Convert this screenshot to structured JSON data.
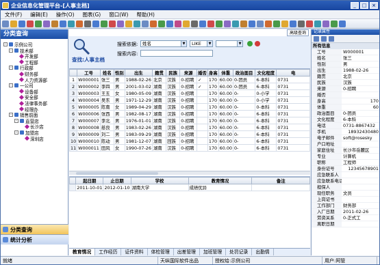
{
  "window": {
    "title": "企业信息化管理平台-[人事主档]"
  },
  "menu": [
    "文件(F)",
    "编辑(E)",
    "操作(O)",
    "图表(G)",
    "窗口(W)",
    "帮助(H)"
  ],
  "left": {
    "title": "分类查询",
    "tree": [
      "示例公司",
      "技术部",
      "开发部",
      "工程部",
      "行政部",
      "财务部",
      "人力资源部",
      "一公司",
      "设备部",
      "安全部",
      "法律事务部",
      "经理办",
      "销售前面",
      "直营店",
      "长沙店",
      "加盟店",
      "深圳店"
    ],
    "buttons": [
      "分类查询",
      "统计分析"
    ]
  },
  "search": {
    "tab": "高级查询",
    "label": "查找:人事主档",
    "by_label": "搜索依据:",
    "by_value": "姓名",
    "op_value": "LIKE",
    "content_label": "搜索内容:",
    "content_value": ""
  },
  "grid": {
    "columns": [
      "工号",
      "姓名",
      "性别",
      "出生",
      "籍贯",
      "民族",
      "来源",
      "婚否",
      "身高",
      "体重",
      "政治面目",
      "文化程度",
      "电"
    ],
    "rows": [
      [
        "1",
        "W000001",
        "张三",
        "男",
        "1988-02-26",
        "北京",
        "汉族",
        "0-招聘",
        "✓",
        "170",
        "60.00",
        "0-团员",
        "6-本科",
        "0731"
      ],
      [
        "2",
        "W000002",
        "李四",
        "男",
        "2001-03-02",
        "湖南",
        "汉族",
        "0-招聘",
        "✓",
        "170",
        "60.00",
        "0-团员",
        "6-本科",
        "0731"
      ],
      [
        "3",
        "W000003",
        "王五",
        "女",
        "1980-05-09",
        "湖南",
        "汉族",
        "0-招聘",
        "",
        "170",
        "60.00",
        "0-",
        "0-小学",
        "0731"
      ],
      [
        "4",
        "W000004",
        "吴东",
        "男",
        "1971-12-29",
        "湖南",
        "汉族",
        "0-招聘",
        "",
        "170",
        "60.00",
        "0-",
        "0-小学",
        "0731"
      ],
      [
        "5",
        "W000005",
        "陈南",
        "女",
        "1989-04-29",
        "湖南",
        "汉族",
        "0-招聘",
        "",
        "170",
        "60.00",
        "0-",
        "0-本科",
        "0731"
      ],
      [
        "6",
        "W000006",
        "张西",
        "男",
        "1982-08-17",
        "湖南",
        "汉族",
        "0-招聘",
        "",
        "170",
        "60.00",
        "0-",
        "6-本科",
        "0731"
      ],
      [
        "7",
        "W000007",
        "李北",
        "男",
        "1976-01-01",
        "湖南",
        "汉族",
        "0-招聘",
        "",
        "170",
        "60.00",
        "0-",
        "6-本科",
        "0731"
      ],
      [
        "8",
        "W000008",
        "慈良",
        "男",
        "1983-02-26",
        "湖南",
        "汉族",
        "0-招聘",
        "",
        "170",
        "60.00",
        "0-",
        "6-本科",
        "0731"
      ],
      [
        "9",
        "W000009",
        "刘二",
        "男",
        "1983-09-29",
        "湖南",
        "汉族",
        "0-招聘",
        "",
        "170",
        "60.00",
        "0-",
        "6-本科",
        "0731"
      ],
      [
        "10",
        "W000010",
        "陈动",
        "男",
        "1981-12-07",
        "湖南",
        "回族",
        "0-招聘",
        "",
        "170",
        "60.00",
        "0-",
        "6-本科",
        "0731"
      ],
      [
        "11",
        "W000011",
        "田风",
        "女",
        "1990-07-26",
        "湖南",
        "汉族",
        "0-招聘",
        "",
        "170",
        "60.00",
        "0-",
        "6-本科",
        "0731"
      ]
    ]
  },
  "grid2": {
    "columns": [
      "起日期",
      "止日期",
      "学校",
      "教育情况",
      "备注"
    ],
    "rows": [
      [
        "2011-10-01",
        "2012-01-10",
        "湖南大学",
        "成绩优异",
        ""
      ]
    ]
  },
  "tabs": [
    "教育情况",
    "工作经历",
    "证件资料",
    "体检管理",
    "出差管理",
    "加班管理",
    "处罚记录",
    "出勤情"
  ],
  "right": {
    "title": "记录属性",
    "category": "所有信息",
    "props": [
      [
        "工号",
        "W000001"
      ],
      [
        "姓名",
        "张三"
      ],
      [
        "性别",
        "男"
      ],
      [
        "出生",
        "1988-02-26"
      ],
      [
        "籍贯",
        "北京"
      ],
      [
        "民族",
        "汉族"
      ],
      [
        "来源",
        "0-招聘"
      ],
      [
        "婚否",
        ""
      ],
      [
        "身高",
        "170"
      ],
      [
        "体重",
        "60"
      ],
      [
        "政治面目",
        "0-团员"
      ],
      [
        "文化程度",
        "6-本科"
      ],
      [
        "电话",
        "0731-8867432"
      ],
      [
        "手机",
        "18932430480"
      ],
      [
        "电子邮件",
        "soft@rosesky"
      ],
      [
        "户口地址",
        ""
      ],
      [
        "家庭住址",
        "长沙市岳麓区"
      ],
      [
        "专业",
        "计算机"
      ],
      [
        "职称",
        "工程师"
      ],
      [
        "身份证号",
        "12345678901"
      ],
      [
        "应急联系人",
        ""
      ],
      [
        "应急联系电话",
        ""
      ],
      [
        "担保人",
        ""
      ],
      [
        "现任职务",
        "文员"
      ],
      [
        "上岗证书",
        ""
      ],
      [
        "工作部门",
        "财务部"
      ],
      [
        "入厂日期",
        "2011-02-26"
      ],
      [
        "劳资关系",
        "0-正式工"
      ],
      [
        "离职日期",
        ""
      ]
    ]
  },
  "status": {
    "ready": "就绪",
    "company": "天纵国际软件出品",
    "license": "授权给:示例公司",
    "user": "用户:阿管"
  }
}
